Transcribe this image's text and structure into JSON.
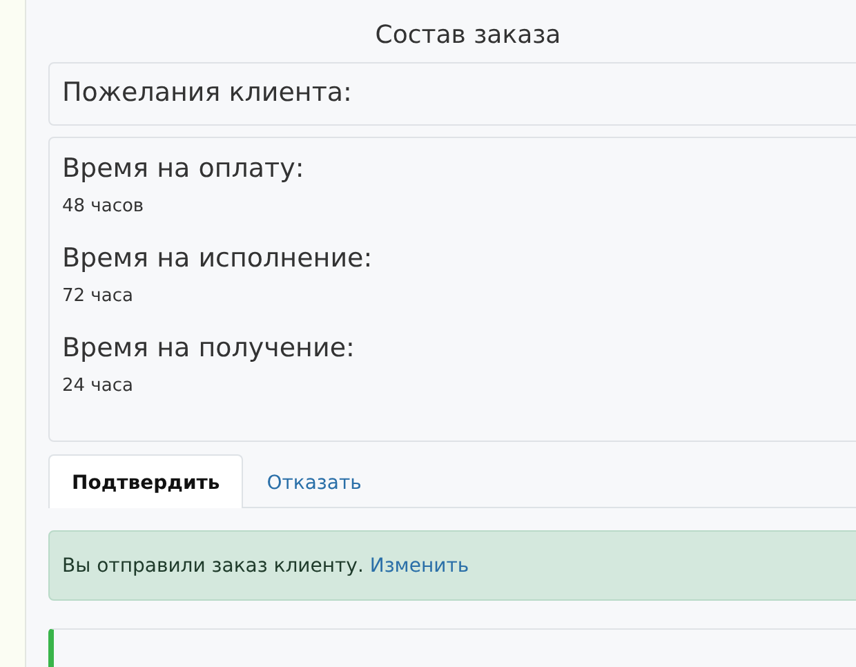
{
  "title": "Состав заказа",
  "wishes": {
    "label": "Пожелания клиента:"
  },
  "times": [
    {
      "label": "Время на оплату:",
      "value": "48 часов"
    },
    {
      "label": "Время на исполнение:",
      "value": "72 часа"
    },
    {
      "label": "Время на получение:",
      "value": "24 часа"
    }
  ],
  "tabs": [
    {
      "label": "Подтвердить",
      "selected": true
    },
    {
      "label": "Отказать",
      "selected": false
    }
  ],
  "alert": {
    "text": "Вы отправили заказ клиенту.",
    "link": "Изменить"
  }
}
